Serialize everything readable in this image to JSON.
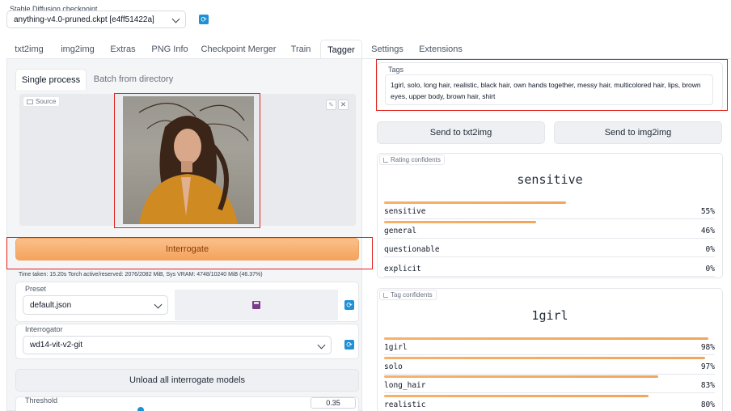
{
  "checkpoint": {
    "label": "Stable Diffusion checkpoint",
    "value": "anything-v4.0-pruned.ckpt [e4ff51422a]"
  },
  "tabs": [
    "txt2img",
    "img2img",
    "Extras",
    "PNG Info",
    "Checkpoint Merger",
    "Train",
    "Tagger",
    "Settings",
    "Extensions"
  ],
  "active_tab": "Tagger",
  "subtabs": [
    "Single process",
    "Batch from directory"
  ],
  "source_label": "Source",
  "interrogate_label": "Interrogate",
  "status_text": "Time taken: 15.20s  Torch active/reserved: 2076/2082 MiB, Sys VRAM: 4748/10240 MiB (46.37%)",
  "preset": {
    "label": "Preset",
    "value": "default.json"
  },
  "interrogator": {
    "label": "Interrogator",
    "value": "wd14-vit-v2-git"
  },
  "unload_label": "Unload all interrogate models",
  "threshold": {
    "label": "Threshold",
    "value": "0.35"
  },
  "tags": {
    "label": "Tags",
    "value": "1girl, solo, long hair, realistic, black hair, own hands together, messy hair, multicolored hair, lips, brown eyes, upper body, brown hair, shirt"
  },
  "send_txt2img": "Send to txt2img",
  "send_img2img": "Send to img2img",
  "rating": {
    "label": "Rating confidents",
    "top": "sensitive",
    "items": [
      {
        "name": "sensitive",
        "pct": "55%",
        "value": 0.55
      },
      {
        "name": "general",
        "pct": "46%",
        "value": 0.46
      },
      {
        "name": "questionable",
        "pct": "0%",
        "value": 0
      },
      {
        "name": "explicit",
        "pct": "0%",
        "value": 0
      }
    ]
  },
  "tag_conf": {
    "label": "Tag confidents",
    "top": "1girl",
    "items": [
      {
        "name": "1girl",
        "pct": "98%",
        "value": 0.98
      },
      {
        "name": "solo",
        "pct": "97%",
        "value": 0.97
      },
      {
        "name": "long_hair",
        "pct": "83%",
        "value": 0.83
      },
      {
        "name": "realistic",
        "pct": "80%",
        "value": 0.8
      }
    ]
  },
  "colors": {
    "accent": "#f5a65f",
    "highlight": "#e0211b",
    "refresh": "#1e90d6"
  }
}
